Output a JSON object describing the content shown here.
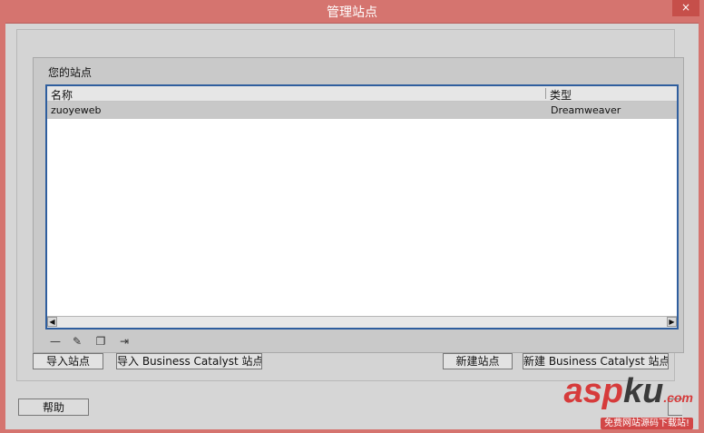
{
  "window": {
    "title": "管理站点",
    "close_icon": "×"
  },
  "sites_label": "您的站点",
  "list": {
    "columns": {
      "name": "名称",
      "type": "类型"
    },
    "rows": [
      {
        "name": "zuoyeweb",
        "type": "Dreamweaver"
      }
    ]
  },
  "toolbar": {
    "remove_icon": "—",
    "edit_icon": "✎",
    "duplicate_icon": "❐",
    "export_icon": "⇥"
  },
  "buttons": {
    "import_site": "导入站点",
    "import_bc_site": "导入 Business Catalyst 站点",
    "new_site": "新建站点",
    "new_bc_site": "新建 Business Catalyst 站点",
    "help": "帮助"
  },
  "scroll": {
    "left_arrow": "◀",
    "right_arrow": "▶"
  },
  "watermark": {
    "logo_main": "asp",
    "logo_sub": "ku",
    "logo_tld": ".com",
    "tagline": "免费网站源码下载站!"
  },
  "colors": {
    "title_bar": "#d5746f",
    "list_border": "#2f5e9e",
    "selected_row": "#c8c8c8"
  }
}
